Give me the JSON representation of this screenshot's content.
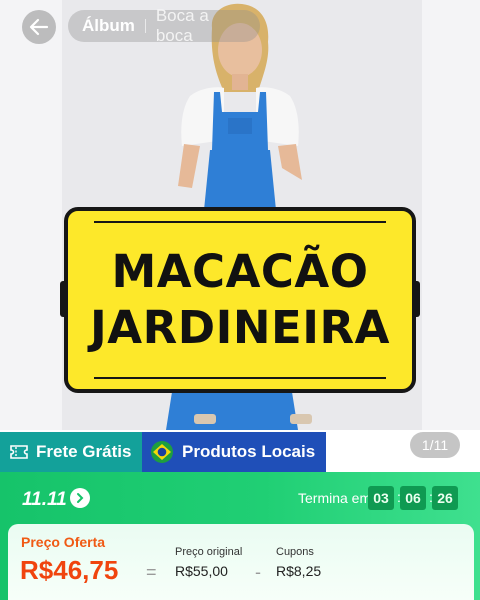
{
  "nav": {
    "tabs": [
      {
        "label": "Álbum"
      },
      {
        "label": "Boca a boca"
      }
    ]
  },
  "sign": {
    "line1": "MACACÃO",
    "line2": "JARDINEIRA"
  },
  "tags": {
    "free_shipping": "Frete Grátis",
    "local_products": "Produtos Locais"
  },
  "gallery": {
    "counter": "1/11"
  },
  "promo": {
    "title": "11.11",
    "timer_label": "Termina em",
    "timer": {
      "hours": "03",
      "minutes": "06",
      "seconds": "26"
    }
  },
  "price": {
    "offer_label": "Preço Oferta",
    "offer_value": "R$46,75",
    "equals": "=",
    "original_label": "Preço original",
    "original_value": "R$55,00",
    "minus": "-",
    "coupon_label": "Cupons",
    "coupon_value": "R$8,25"
  },
  "colors": {
    "accent_orange": "#f0440e",
    "promo_green": "#16c36a",
    "free_shipping_teal": "#13a19a",
    "local_products_blue": "#1f4fb8",
    "sign_yellow": "#fde82a"
  }
}
